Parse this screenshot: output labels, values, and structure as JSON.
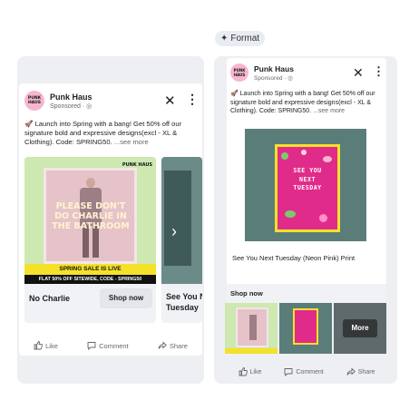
{
  "format_label": "Format",
  "ad": {
    "brand": "Punk Haus",
    "logo_text": "PUNK HAUS",
    "sponsored": "Sponsored · ",
    "caption": "🚀 Launch into Spring with a bang! Get 50% off our signature bold and expressive designs(excl - XL & Clothing). Code: SPRING50.",
    "caption_more": "...see more",
    "caption_more_right": "...see more"
  },
  "carousel": {
    "card1": {
      "poster_text": "PLEASE DON'T DO CHARLIE IN THE BATHROOM",
      "banner": "SPRING SALE IS LIVE",
      "flat_line": "FLAT 50% OFF SITEWIDE, CODE - SPRING50",
      "title": "No Charlie",
      "cta": "Shop now",
      "logo_text": "PUNK HAUS"
    },
    "card2": {
      "title": "See You Next Tuesday"
    }
  },
  "single": {
    "poster_text": "SEE YOU NEXT TUESDAY",
    "title": "See You Next Tuesday (Neon Pink) Print",
    "shop_now": "Shop now",
    "more": "More"
  },
  "actions": {
    "like": "Like",
    "comment": "Comment",
    "share": "Share"
  },
  "colors": {
    "logo_pink": "#f7b6cf",
    "sale_yellow": "#f5e12a",
    "poster_pink": "#e02b8a",
    "wall_teal": "#5b7d7a",
    "poster_green_bg": "#cde8b0"
  }
}
